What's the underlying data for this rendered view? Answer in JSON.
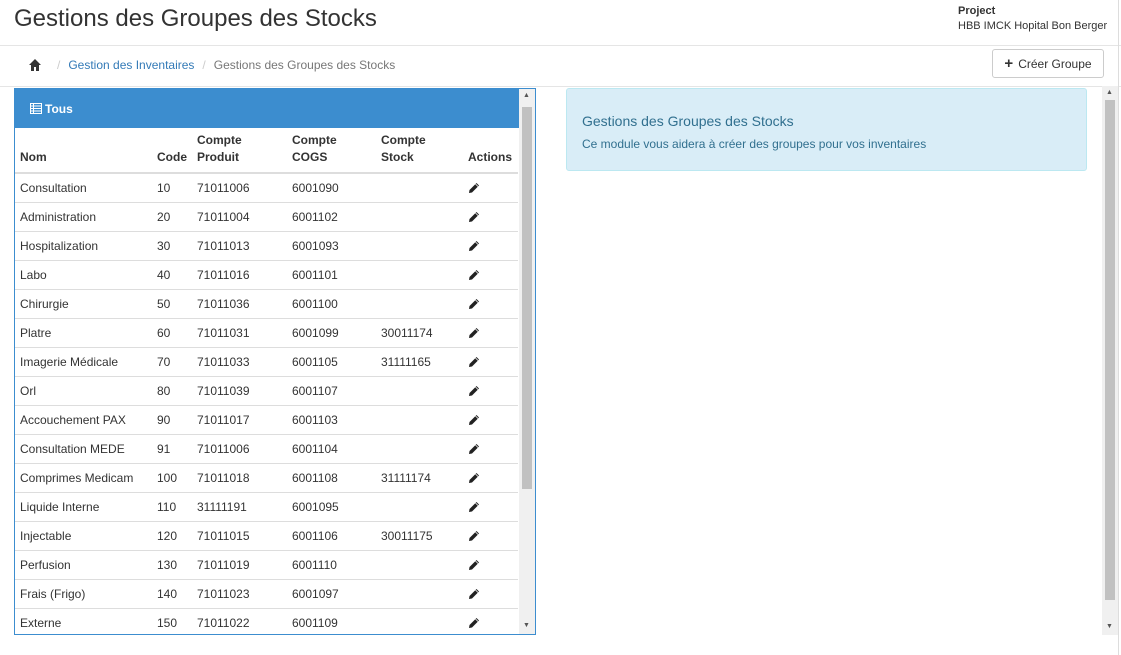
{
  "header": {
    "title": "Gestions des Groupes des Stocks",
    "project_label": "Project",
    "project_name": "HBB IMCK Hopital Bon Berger"
  },
  "breadcrumb": {
    "home_icon": "home-icon",
    "items": [
      "Gestion des Inventaires",
      "Gestions des Groupes des Stocks"
    ],
    "separator": "/"
  },
  "toolbar": {
    "create_label": "Créer Groupe",
    "create_icon": "plus-icon"
  },
  "panel": {
    "title": "Tous",
    "icon": "table-icon",
    "accent": "#3c8dcf",
    "columns": [
      "Nom",
      "Code",
      "Compte Produit",
      "Compte COGS",
      "Compte Stock",
      "Actions"
    ],
    "rows": [
      {
        "nom": "Consultation",
        "code": "10",
        "produit": "71011006",
        "cogs": "6001090",
        "stock": ""
      },
      {
        "nom": "Administration",
        "code": "20",
        "produit": "71011004",
        "cogs": "6001102",
        "stock": ""
      },
      {
        "nom": "Hospitalization",
        "code": "30",
        "produit": "71011013",
        "cogs": "6001093",
        "stock": ""
      },
      {
        "nom": "Labo",
        "code": "40",
        "produit": "71011016",
        "cogs": "6001101",
        "stock": ""
      },
      {
        "nom": "Chirurgie",
        "code": "50",
        "produit": "71011036",
        "cogs": "6001100",
        "stock": ""
      },
      {
        "nom": "Platre",
        "code": "60",
        "produit": "71011031",
        "cogs": "6001099",
        "stock": "30011174"
      },
      {
        "nom": "Imagerie Médicale",
        "code": "70",
        "produit": "71011033",
        "cogs": "6001105",
        "stock": "31111165"
      },
      {
        "nom": "Orl",
        "code": "80",
        "produit": "71011039",
        "cogs": "6001107",
        "stock": ""
      },
      {
        "nom": "Accouchement PAX",
        "code": "90",
        "produit": "71011017",
        "cogs": "6001103",
        "stock": ""
      },
      {
        "nom": "Consultation MEDE",
        "code": "91",
        "produit": "71011006",
        "cogs": "6001104",
        "stock": ""
      },
      {
        "nom": "Comprimes Medicam",
        "code": "100",
        "produit": "71011018",
        "cogs": "6001108",
        "stock": "31111174"
      },
      {
        "nom": "Liquide Interne",
        "code": "110",
        "produit": "31111191",
        "cogs": "6001095",
        "stock": ""
      },
      {
        "nom": "Injectable",
        "code": "120",
        "produit": "71011015",
        "cogs": "6001106",
        "stock": "30011175"
      },
      {
        "nom": "Perfusion",
        "code": "130",
        "produit": "71011019",
        "cogs": "6001110",
        "stock": ""
      },
      {
        "nom": "Frais (Frigo)",
        "code": "140",
        "produit": "71011023",
        "cogs": "6001097",
        "stock": ""
      },
      {
        "nom": "Externe",
        "code": "150",
        "produit": "71011022",
        "cogs": "6001109",
        "stock": ""
      }
    ],
    "action_icon": "pencil-icon"
  },
  "info": {
    "title": "Gestions des Groupes des Stocks",
    "text": "Ce module vous aidera à créer des groupes pour vos inventaires",
    "bg": "#d9edf7",
    "color": "#31708f"
  }
}
